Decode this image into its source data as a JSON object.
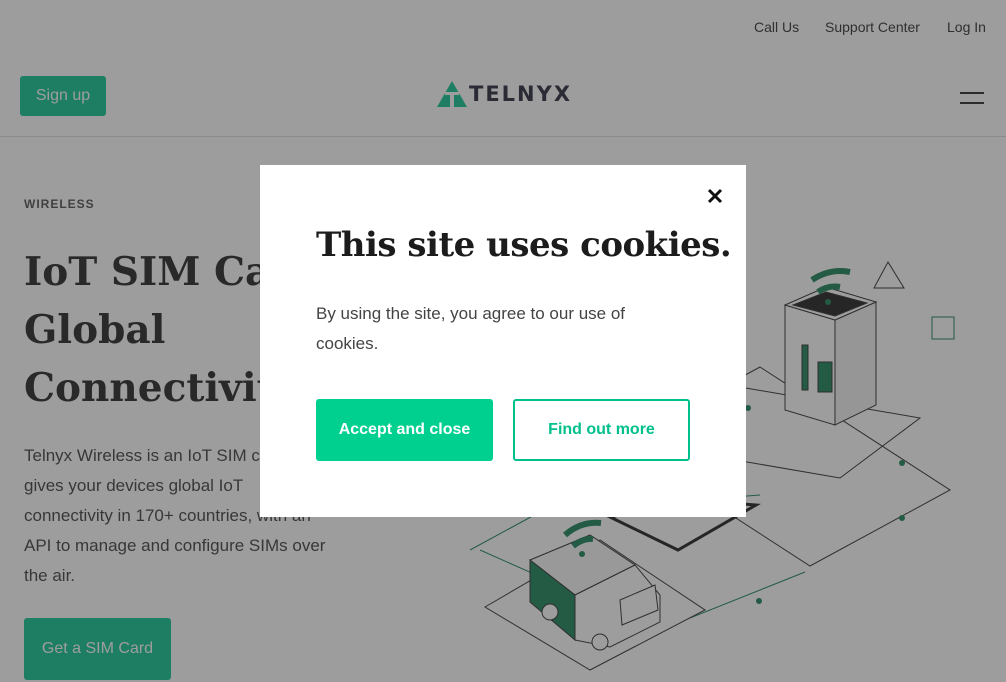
{
  "topnav": {
    "call_us": "Call Us",
    "support_center": "Support Center",
    "log_in": "Log In"
  },
  "header": {
    "signup_label": "Sign up",
    "logo_text": "TELNYX",
    "brand_color": "#00c08b"
  },
  "hero": {
    "eyebrow": "WIRELESS",
    "title_line1": "IoT SIM Card",
    "title_line2": "Global",
    "title_line3": "Connectivity",
    "body": "Telnyx Wireless is an IoT SIM card that gives your devices global IoT connectivity in 170+ countries, with an API to manage and configure SIMs over the air.",
    "cta_label": "Get a SIM Card"
  },
  "cookie_modal": {
    "title": "This site uses cookies.",
    "text": "By using the site, you agree to our use of cookies.",
    "accept_label": "Accept and close",
    "more_label": "Find out more",
    "close_icon": "close-icon"
  }
}
